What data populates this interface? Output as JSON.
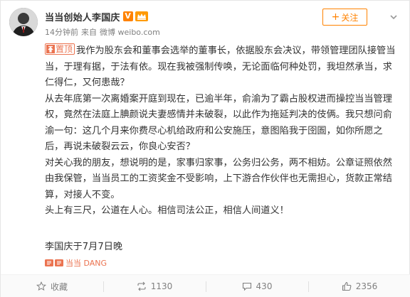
{
  "header": {
    "user_name": "当当创始人李国庆",
    "verified_badge": "V",
    "crown_icon": "vip-crown-icon",
    "time": "14分钟前",
    "source_prefix": "来自",
    "source": "微博 weibo.com",
    "follow_label": "关注"
  },
  "post": {
    "pin_label": "置顶",
    "paragraphs": [
      "我作为股东会和董事会选举的董事长，依据股东会决议，带领管理团队接管当当，于理有据，于法有依。现在我被强制传唤，无论面临何种处罚，我坦然承当，求仁得仁，又何患哉？",
      "从去年底第一次离婚案开庭到现在，已逾半年，俞渝为了霸占股权进而操控当当管理权，竟然在法庭上腆颜说夫妻感情并未破裂，以此作为拖延判决的伎俩。我只想问俞渝一句：这几个月来你费尽心机给政府和公安施压，意图陷我于囹圄，如你所愿之后，再说未破裂云云，你良心安否？",
      "对关心我的朋友，想说明的是，家事归家事，公务归公务，两不相妨。公章证照依然由我保管，当当员工的工资奖金不受影响，上下游合作伙伴也无需担心，货款正常结算，对接人不变。",
      "头上有三尺，公道在人心。相信司法公正，相信人间道义！"
    ],
    "signature": "李国庆于7月7日晚",
    "source_link": "当当 DANG"
  },
  "actions": {
    "favorite_label": "收藏",
    "repost_count": "1130",
    "comment_count": "430",
    "like_count": "2356"
  },
  "colors": {
    "accent": "#ff8200",
    "link": "#eb7350",
    "text": "#333333",
    "muted": "#808080"
  }
}
